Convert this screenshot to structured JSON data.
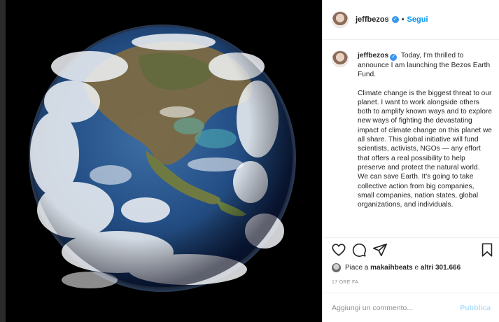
{
  "post": {
    "image_alt": "Earth",
    "username": "jeffbezos",
    "separator": "•",
    "follow_label": "Segui",
    "caption": {
      "username": "jeffbezos",
      "paragraph1": "Today, I'm thrilled to announce I am launching the Bezos Earth Fund.",
      "paragraph2": "Climate change is the biggest threat to our planet. I want to work alongside others both to amplify known ways and to explore new ways of fighting the devastating impact of climate change on this planet we all share. This global initiative will fund scientists, activists, NGOs — any effort that offers a real possibility to help preserve and protect the natural world. We can save Earth. It's going to take collective action from big companies, small companies, nation states, global organizations, and individuals."
    },
    "likes": {
      "prefix": "Piace a",
      "user": "makaihbeats",
      "middle": "e",
      "others": "altri 301.666"
    },
    "time_ago": "17 ORE FA",
    "comment": {
      "placeholder": "Aggiungi un commento...",
      "value": "",
      "publish_label": "Pubblica"
    }
  },
  "icons": {
    "like": "heart-icon",
    "comment": "comment-icon",
    "share": "paper-plane-icon",
    "save": "bookmark-icon",
    "verified": "verified-badge-icon"
  },
  "colors": {
    "link_blue": "#0095f6",
    "publish_disabled": "#b2dffc",
    "verified_blue": "#3897f0",
    "muted": "#8e8e8e"
  }
}
